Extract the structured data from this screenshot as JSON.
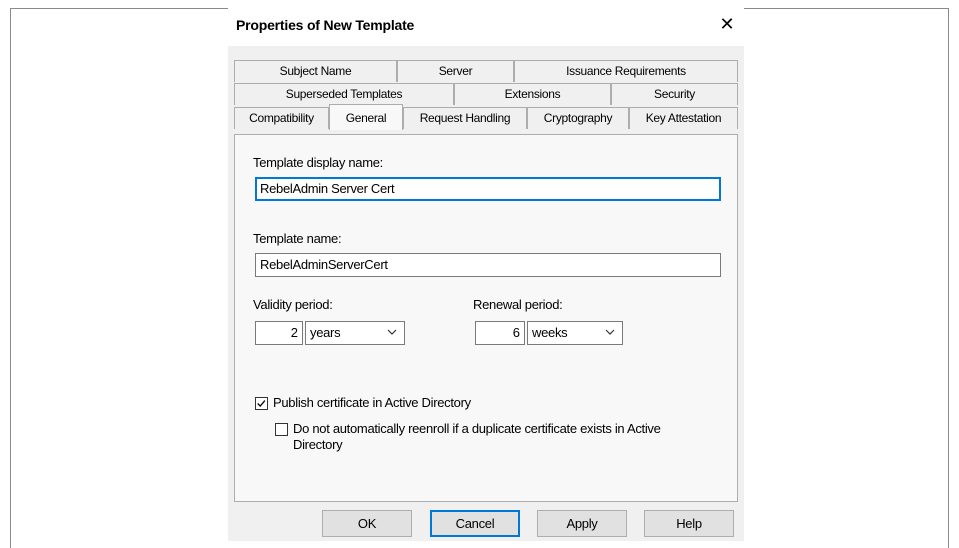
{
  "dialog": {
    "title": "Properties of New Template",
    "close_symbol": "✕"
  },
  "tabs": {
    "row1": [
      "Subject Name",
      "Server",
      "Issuance Requirements"
    ],
    "row2": [
      "Superseded Templates",
      "Extensions",
      "Security"
    ],
    "row3": [
      "Compatibility",
      "General",
      "Request Handling",
      "Cryptography",
      "Key Attestation"
    ],
    "active": "General"
  },
  "general": {
    "display_name_label": "Template display name:",
    "display_name_value": "RebelAdmin Server Cert",
    "template_name_label": "Template name:",
    "template_name_value": "RebelAdminServerCert",
    "validity_label": "Validity period:",
    "validity_value": "2",
    "validity_unit": "years",
    "renewal_label": "Renewal period:",
    "renewal_value": "6",
    "renewal_unit": "weeks",
    "publish_label": "Publish certificate in Active Directory",
    "publish_checked": true,
    "reenroll_label_line1": "Do not automatically reenroll if a duplicate certificate exists in Active",
    "reenroll_label_line2": "Directory",
    "reenroll_checked": false
  },
  "buttons": {
    "ok": "OK",
    "cancel": "Cancel",
    "apply": "Apply",
    "help": "Help"
  },
  "icons": {
    "close": "close-icon",
    "chevron": "chevron-down-icon",
    "check": "checkmark-icon"
  },
  "colors": {
    "accent": "#0078d7",
    "dialog_bg": "#f0f0f0",
    "panel_bg": "#f8f8f8"
  }
}
